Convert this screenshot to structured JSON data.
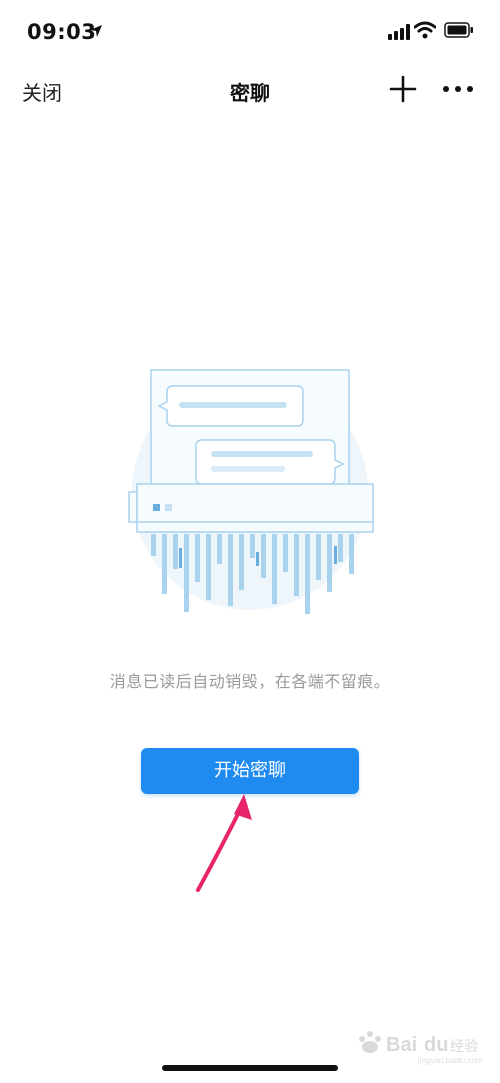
{
  "status_bar": {
    "time": "09:03",
    "icons": [
      "location-arrow-icon",
      "signal-icon",
      "wifi-icon",
      "battery-icon"
    ]
  },
  "nav": {
    "close_label": "关闭",
    "title": "密聊",
    "add_icon": "plus-icon",
    "more_icon": "more-icon"
  },
  "main": {
    "illustration": "message-shredder-illustration",
    "description": "消息已读后自动销毁，在各端不留痕。",
    "start_button_label": "开始密聊"
  },
  "annotation": {
    "arrow_color": "#e8246b",
    "arrow_icon": "pointer-arrow-icon"
  },
  "watermark": {
    "logo_text": "Bai du 经验",
    "url": "jingyan.baidu.com"
  },
  "colors": {
    "accent": "#1f8bf0",
    "illustration_circle": "#eef5fb",
    "illustration_line": "#a9d2ee",
    "illustration_bar": "#c7e1f4"
  }
}
